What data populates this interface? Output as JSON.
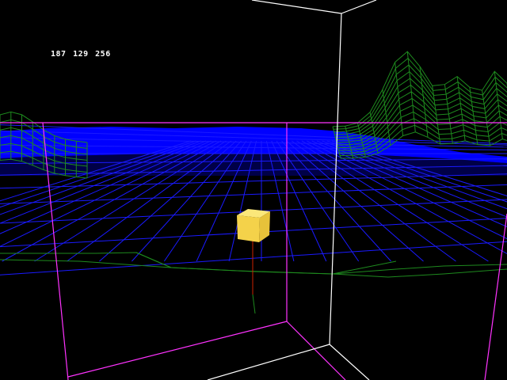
{
  "hud": {
    "coordinates": "187 129 256"
  },
  "colors": {
    "background": "#000000",
    "terrain_wire": "#1e8a1e",
    "water_fill": "#0000ff",
    "water_grid": "#1a1aff",
    "box_edges_magenta": "#ff33ff",
    "box_edges_white": "#ffffff",
    "cube": "#f4d24a",
    "cursor_line": "#cc2200"
  }
}
